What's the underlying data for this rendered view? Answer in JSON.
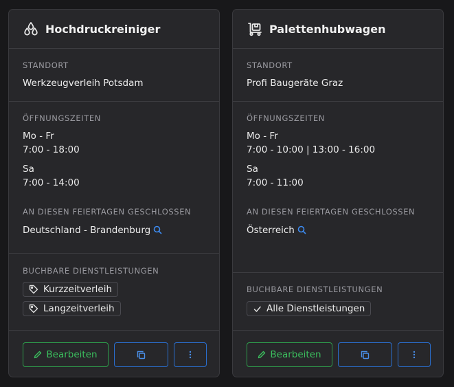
{
  "labels": {
    "location": "STANDORT",
    "hours": "ÖFFNUNGSZEITEN",
    "holidays": "AN DIESEN FEIERTAGEN GESCHLOSSEN",
    "services": "BUCHBARE DIENSTLEISTUNGEN",
    "edit": "Bearbeiten"
  },
  "cards": [
    {
      "title": "Hochdruckreiniger",
      "icon": "water-drops-icon",
      "location": "Werkzeugverleih Potsdam",
      "hours": [
        {
          "days": "Mo - Fr",
          "times": "7:00 - 18:00"
        },
        {
          "days": "Sa",
          "times": "7:00 - 14:00"
        }
      ],
      "holidays": "Deutschland - Brandenburg",
      "services": [
        "Kurzzeitverleih",
        "Langzeitverleih"
      ]
    },
    {
      "title": "Palettenhubwagen",
      "icon": "pallet-truck-icon",
      "location": "Profi Baugeräte Graz",
      "hours": [
        {
          "days": "Mo - Fr",
          "times": "7:00 - 10:00 | 13:00 - 16:00"
        },
        {
          "days": "Sa",
          "times": "7:00 - 11:00"
        }
      ],
      "holidays": "Österreich",
      "services": [
        "Alle Dienstleistungen"
      ]
    }
  ],
  "colors": {
    "background": "#18181a",
    "card": "#27272a",
    "edit_green": "#3bbf5e",
    "accent_blue": "#2a6fd0"
  }
}
